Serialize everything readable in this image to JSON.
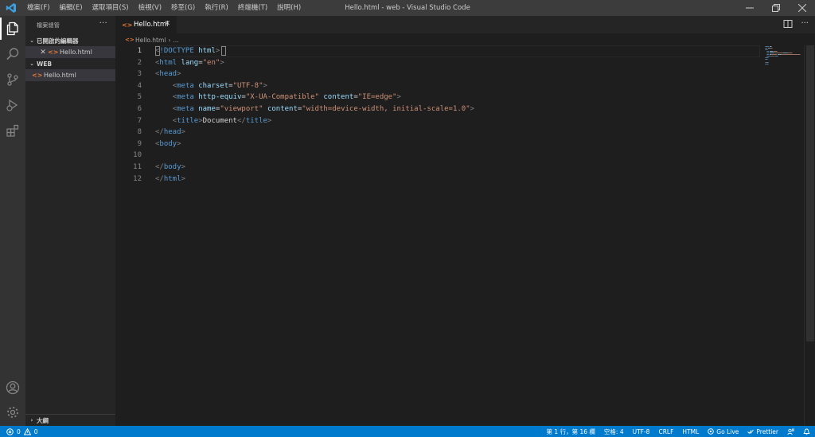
{
  "app": {
    "window_title": "Hello.html - web - Visual Studio Code",
    "menu": [
      "檔案(F)",
      "編輯(E)",
      "選取項目(S)",
      "檢視(V)",
      "移至(G)",
      "執行(R)",
      "終端機(T)",
      "說明(H)"
    ]
  },
  "sidebar": {
    "title": "檔案總管",
    "open_editors_label": "已開啟的編輯器",
    "open_editor_file": "Hello.html",
    "workspace_label": "WEB",
    "workspace_file": "Hello.html",
    "outline_label": "大綱"
  },
  "editor": {
    "tab_label": "Hello.html",
    "breadcrumb_file": "Hello.html",
    "breadcrumb_more": "...",
    "line_numbers": [
      "1",
      "2",
      "3",
      "4",
      "5",
      "6",
      "7",
      "8",
      "9",
      "10",
      "11",
      "12"
    ],
    "lines": [
      [
        [
          "punc",
          "<"
        ],
        [
          "tag",
          "!DOCTYPE"
        ],
        [
          "text",
          " "
        ],
        [
          "attr",
          "html"
        ],
        [
          "punc",
          ">"
        ]
      ],
      [
        [
          "punc",
          "<"
        ],
        [
          "tag",
          "html"
        ],
        [
          "text",
          " "
        ],
        [
          "attr",
          "lang"
        ],
        [
          "text",
          "="
        ],
        [
          "str",
          "\"en\""
        ],
        [
          "punc",
          ">"
        ]
      ],
      [
        [
          "punc",
          "<"
        ],
        [
          "tag",
          "head"
        ],
        [
          "punc",
          ">"
        ]
      ],
      [
        [
          "text",
          "    "
        ],
        [
          "punc",
          "<"
        ],
        [
          "tag",
          "meta"
        ],
        [
          "text",
          " "
        ],
        [
          "attr",
          "charset"
        ],
        [
          "text",
          "="
        ],
        [
          "str",
          "\"UTF-8\""
        ],
        [
          "punc",
          ">"
        ]
      ],
      [
        [
          "text",
          "    "
        ],
        [
          "punc",
          "<"
        ],
        [
          "tag",
          "meta"
        ],
        [
          "text",
          " "
        ],
        [
          "attr",
          "http-equiv"
        ],
        [
          "text",
          "="
        ],
        [
          "str",
          "\"X-UA-Compatible\""
        ],
        [
          "text",
          " "
        ],
        [
          "attr",
          "content"
        ],
        [
          "text",
          "="
        ],
        [
          "str",
          "\"IE=edge\""
        ],
        [
          "punc",
          ">"
        ]
      ],
      [
        [
          "text",
          "    "
        ],
        [
          "punc",
          "<"
        ],
        [
          "tag",
          "meta"
        ],
        [
          "text",
          " "
        ],
        [
          "attr",
          "name"
        ],
        [
          "text",
          "="
        ],
        [
          "str",
          "\"viewport\""
        ],
        [
          "text",
          " "
        ],
        [
          "attr",
          "content"
        ],
        [
          "text",
          "="
        ],
        [
          "str",
          "\"width=device-width, initial-scale=1.0\""
        ],
        [
          "punc",
          ">"
        ]
      ],
      [
        [
          "text",
          "    "
        ],
        [
          "punc",
          "<"
        ],
        [
          "tag",
          "title"
        ],
        [
          "punc",
          ">"
        ],
        [
          "text",
          "Document"
        ],
        [
          "punc",
          "</"
        ],
        [
          "tag",
          "title"
        ],
        [
          "punc",
          ">"
        ]
      ],
      [
        [
          "punc",
          "</"
        ],
        [
          "tag",
          "head"
        ],
        [
          "punc",
          ">"
        ]
      ],
      [
        [
          "punc",
          "<"
        ],
        [
          "tag",
          "body"
        ],
        [
          "punc",
          ">"
        ]
      ],
      [],
      [
        [
          "punc",
          "</"
        ],
        [
          "tag",
          "body"
        ],
        [
          "punc",
          ">"
        ]
      ],
      [
        [
          "punc",
          "</"
        ],
        [
          "tag",
          "html"
        ],
        [
          "punc",
          ">"
        ]
      ]
    ]
  },
  "statusbar": {
    "errors": "0",
    "warnings": "0",
    "position": "第 1 行，第 16 欄",
    "spaces": "空格: 4",
    "encoding": "UTF-8",
    "eol": "CRLF",
    "language": "HTML",
    "golive": "Go Live",
    "prettier": "Prettier"
  },
  "colors": {
    "accent": "#007acc",
    "html_icon": "#e37933",
    "tag": "#569cd6",
    "attribute": "#9cdcfe",
    "string": "#ce9178"
  }
}
